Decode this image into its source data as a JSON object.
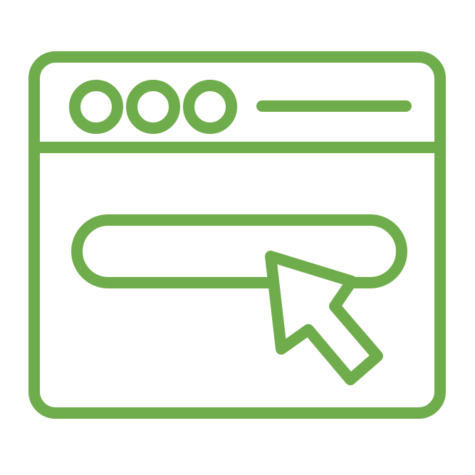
{
  "icon": {
    "name": "browser-window-click-icon",
    "color": "#6fac4b",
    "background": "#ffffff",
    "window_dots": 3,
    "elements": [
      "browser-window",
      "window-control-dots",
      "address-bar-line",
      "search-input-box",
      "mouse-cursor"
    ]
  }
}
